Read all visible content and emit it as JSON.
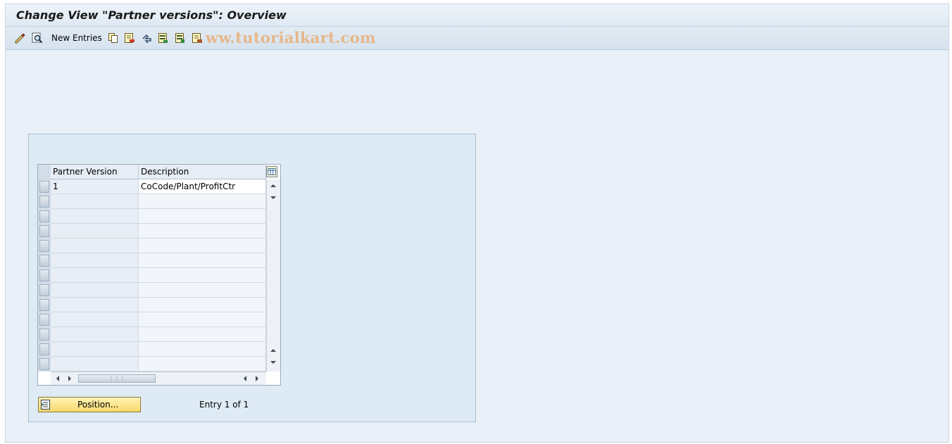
{
  "window": {
    "title": "Change View \"Partner versions\": Overview"
  },
  "toolbar": {
    "new_entries_label": "New Entries",
    "watermark": "ww.tutorialkart.com",
    "icons": [
      "display-change-icon",
      "find-icon",
      "copy-icon",
      "delete-icon",
      "undo-change-icon",
      "select-all-icon",
      "select-block-icon",
      "deselect-all-icon"
    ]
  },
  "table": {
    "columns": [
      "Partner Version",
      "Description"
    ],
    "rows": [
      {
        "partner_version": "1",
        "description": "CoCode/Plant/ProfitCtr"
      }
    ],
    "empty_rows": 12
  },
  "footer": {
    "position_label": "Position...",
    "entry_text": "Entry 1 of 1"
  },
  "colors": {
    "background": "#e9f0f7",
    "button_yellow": "#f7d86b",
    "watermark": "#e7b78a"
  }
}
